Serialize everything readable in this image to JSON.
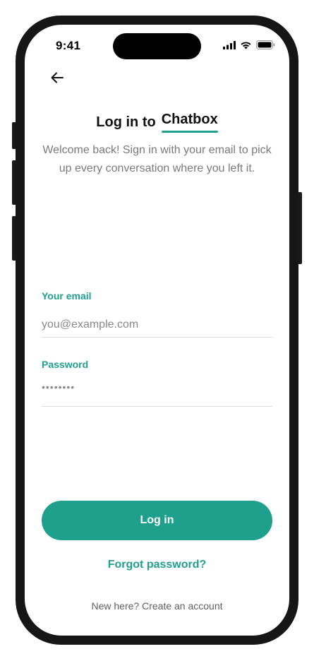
{
  "status_bar": {
    "time": "9:41",
    "icons": [
      "signal-icon",
      "wifi-icon",
      "battery-icon"
    ]
  },
  "header": {
    "back_icon": "arrow-left-icon",
    "title_prefix": "Log in to",
    "title_brand": "Chatbox",
    "subtitle": "Welcome back! Sign in with your email to pick up every conversation where you left it."
  },
  "form": {
    "email_label": "Your email",
    "email_placeholder": "you@example.com",
    "password_label": "Password",
    "password_value": "••••••••"
  },
  "actions": {
    "login_label": "Log in",
    "forgot_label": "Forgot password?",
    "create_label": "New here? Create an account"
  },
  "colors": {
    "accent": "#1fa08e",
    "text_primary": "#111111",
    "text_muted": "#7a7a7a",
    "divider": "#dcdcdc"
  }
}
